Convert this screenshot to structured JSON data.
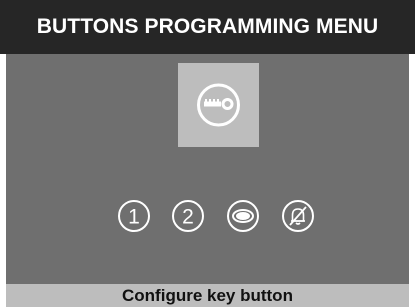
{
  "header": {
    "title": "BUTTONS PROGRAMMING MENU"
  },
  "menu": {
    "selected": {
      "icon": "key-icon"
    },
    "options": [
      {
        "icon": "button-1-icon",
        "label": "1"
      },
      {
        "icon": "button-2-icon",
        "label": "2"
      },
      {
        "icon": "eye-icon"
      },
      {
        "icon": "bell-off-icon"
      }
    ]
  },
  "status": {
    "text": "Configure key button"
  },
  "colors": {
    "title_bar": "#262626",
    "panel": "#6f6f6f",
    "highlight": "#bdbdbd",
    "icon_stroke": "#ffffff"
  }
}
